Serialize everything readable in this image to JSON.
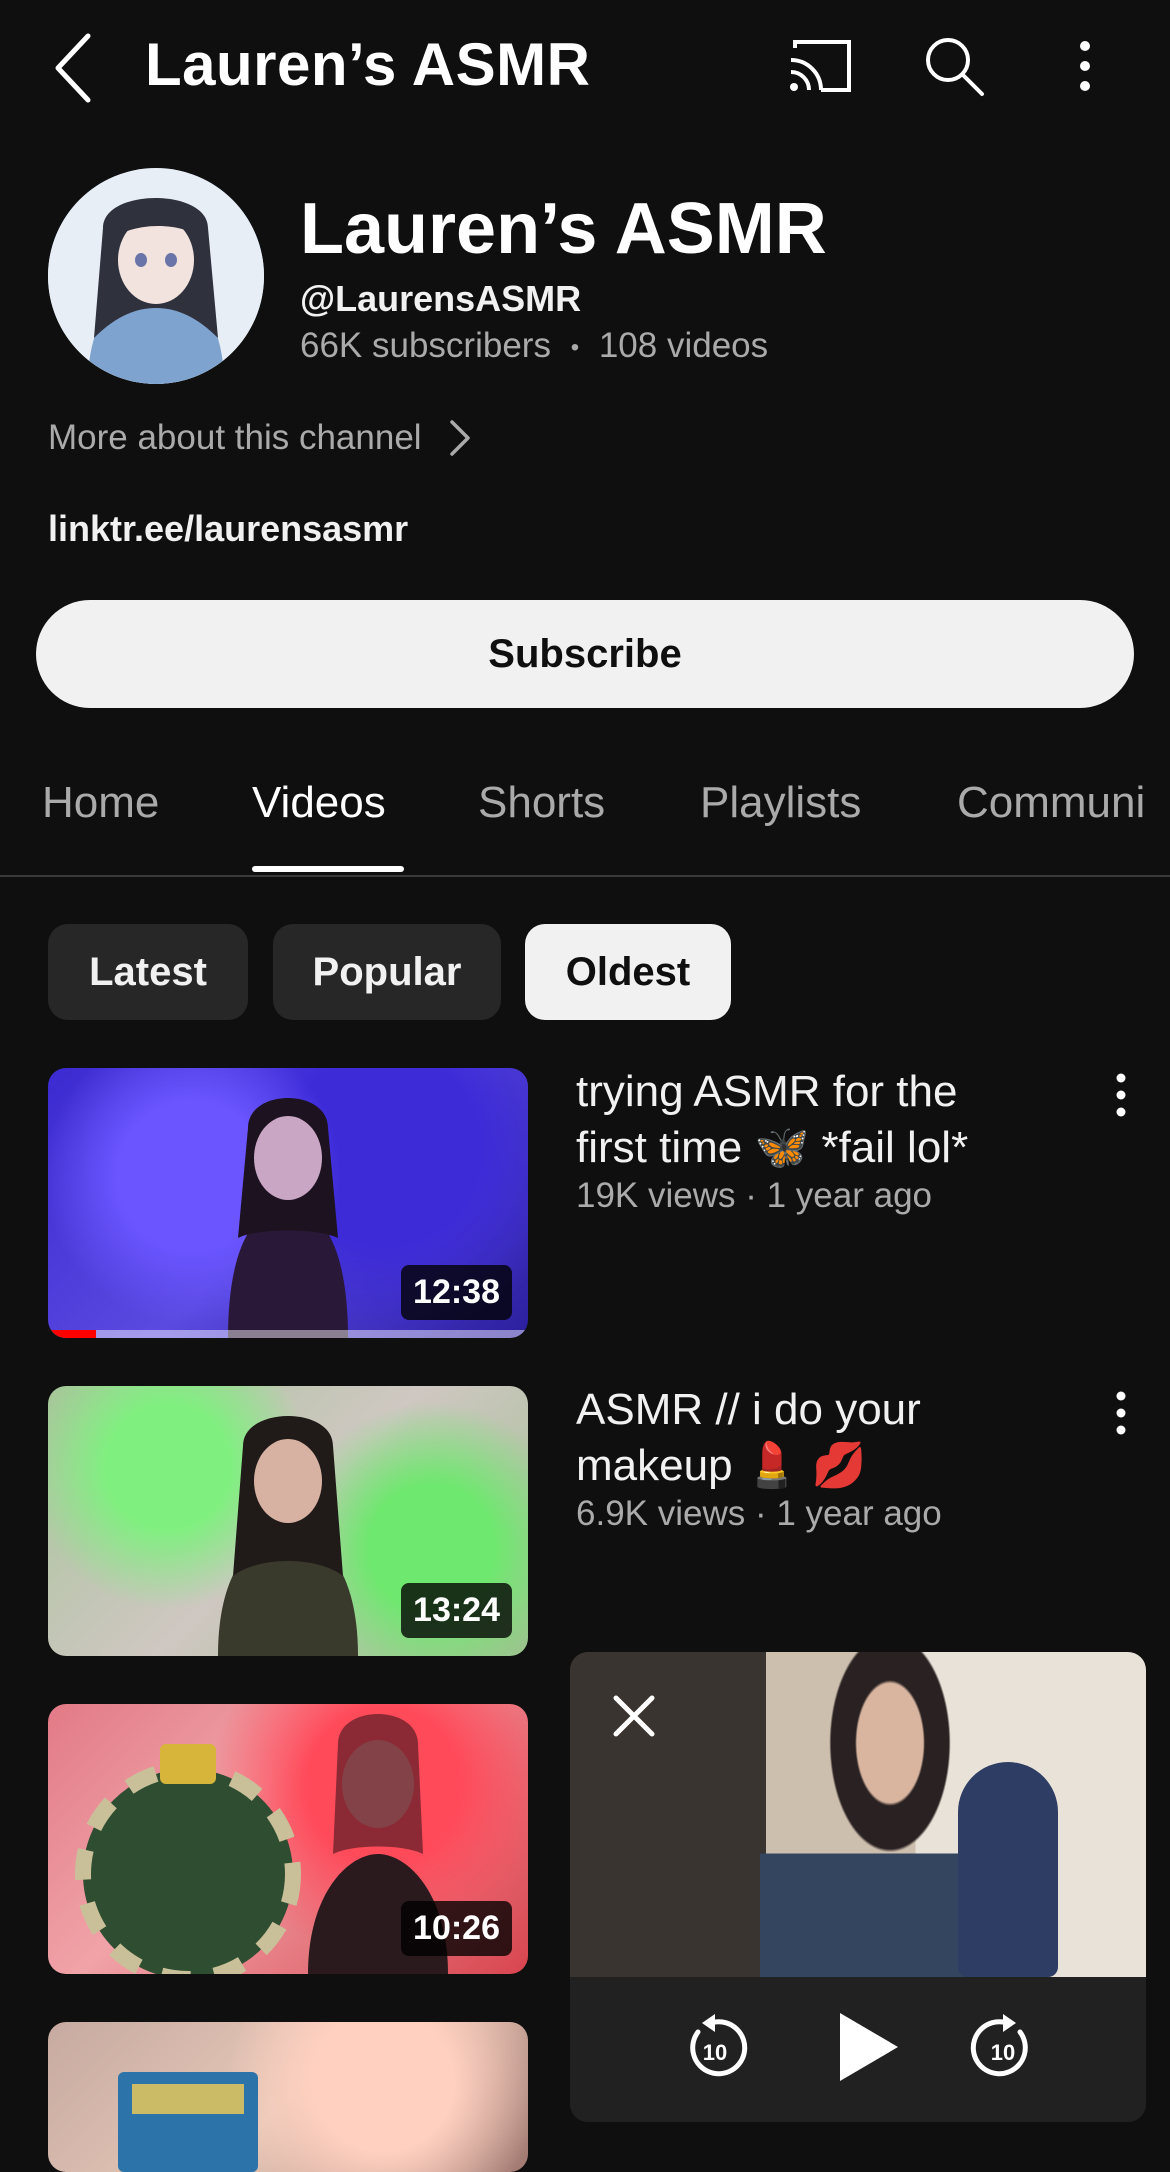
{
  "header": {
    "title": "Lauren’s ASMR"
  },
  "channel": {
    "name": "Lauren’s ASMR",
    "handle": "@LaurensASMR",
    "subscribers": "66K subscribers",
    "separator": "•",
    "video_count": "108 videos",
    "more_about": "More about this channel",
    "link": "linktr.ee/laurensasmr",
    "subscribe_label": "Subscribe"
  },
  "tabs": [
    {
      "label": "Home"
    },
    {
      "label": "Videos"
    },
    {
      "label": "Shorts"
    },
    {
      "label": "Playlists"
    },
    {
      "label": "Communi"
    }
  ],
  "active_tab": "Videos",
  "chips": [
    {
      "label": "Latest"
    },
    {
      "label": "Popular"
    },
    {
      "label": "Oldest"
    }
  ],
  "selected_chip": "Oldest",
  "videos": [
    {
      "title_line1": "trying ASMR for the",
      "title_line2": "first time 🦋  *fail lol*",
      "meta": "19K views · 1 year ago",
      "duration": "12:38",
      "watched_fraction": 0.1
    },
    {
      "title_line1": "ASMR // i do your",
      "title_line2": "makeup 💄 💋",
      "meta": "6.9K views · 1 year ago",
      "duration": "13:24"
    },
    {
      "duration": "10:26"
    },
    {
      "duration": ""
    }
  ],
  "mini_player": {
    "rewind_label": "10",
    "forward_label": "10"
  },
  "colors": {
    "background": "#0f0f0f",
    "progress": "#ff0000",
    "chip_selected": "#f1f1f1"
  }
}
